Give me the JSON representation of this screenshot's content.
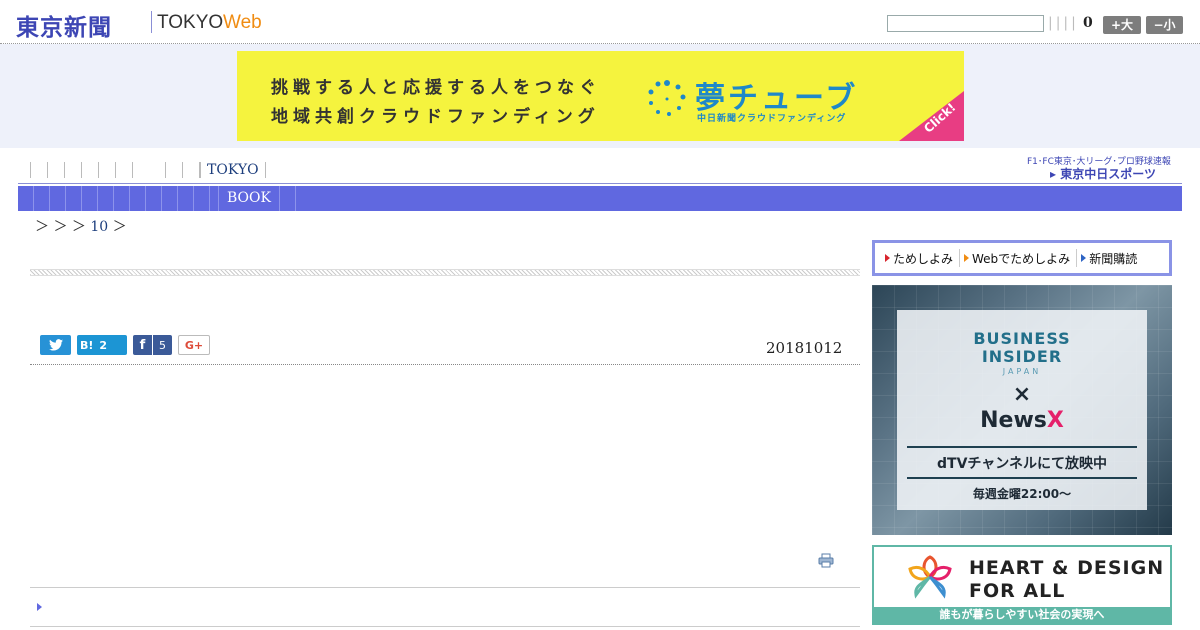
{
  "header": {
    "logo_text": "東京新聞",
    "logo_tokyo": "TOKYO",
    "logo_web": "Web",
    "search_value": "",
    "separators": "||||",
    "counter": "0",
    "font_large_label": "+大",
    "font_small_label": "−小"
  },
  "ad_banner": {
    "line1": "挑戦する人と応援する人をつなぐ",
    "line2": "地域共創クラウドファンディング",
    "title": "夢チューブ",
    "subtitle": "中日新聞クラウドファンディング",
    "corner": "Click!",
    "bg_color": "#f5f33e",
    "accent_color": "#1e88c9"
  },
  "nav": {
    "primary_tokyo": "TOKYO",
    "secondary_book": "BOOK",
    "sports_line1": "F1･FC東京･大リーグ･プロ野球速報",
    "sports_line2": "東京中日スポーツ",
    "bar_color": "#6068e0"
  },
  "breadcrumb": {
    "prefix": "＞ ＞ ＞",
    "link": "10",
    "suffix": "＞"
  },
  "article": {
    "date": "20181012",
    "share": {
      "twitter_icon": "twitter-icon",
      "hatena_label": "B!",
      "hatena_count": "2",
      "facebook_icon": "f",
      "facebook_count": "5",
      "gplus_label": "G+"
    },
    "print_icon": "printer-icon"
  },
  "sidebar": {
    "tabs": [
      {
        "label": "ためしよみ"
      },
      {
        "label": "Webでためしよみ"
      },
      {
        "label": "新聞購読"
      }
    ],
    "ad_bi": {
      "line1": "BUSINESS",
      "line2": "INSIDER",
      "japan": "JAPAN",
      "x": "×",
      "news": "News",
      "newsx": "X",
      "dtv": "dTVチャンネルにて放映中",
      "time": "毎週金曜22:00〜"
    },
    "ad_heart": {
      "line1": "HEART & DESIGN",
      "line2": "FOR ALL",
      "bar": "誰もが暮らしやすい社会の実現へ"
    }
  }
}
